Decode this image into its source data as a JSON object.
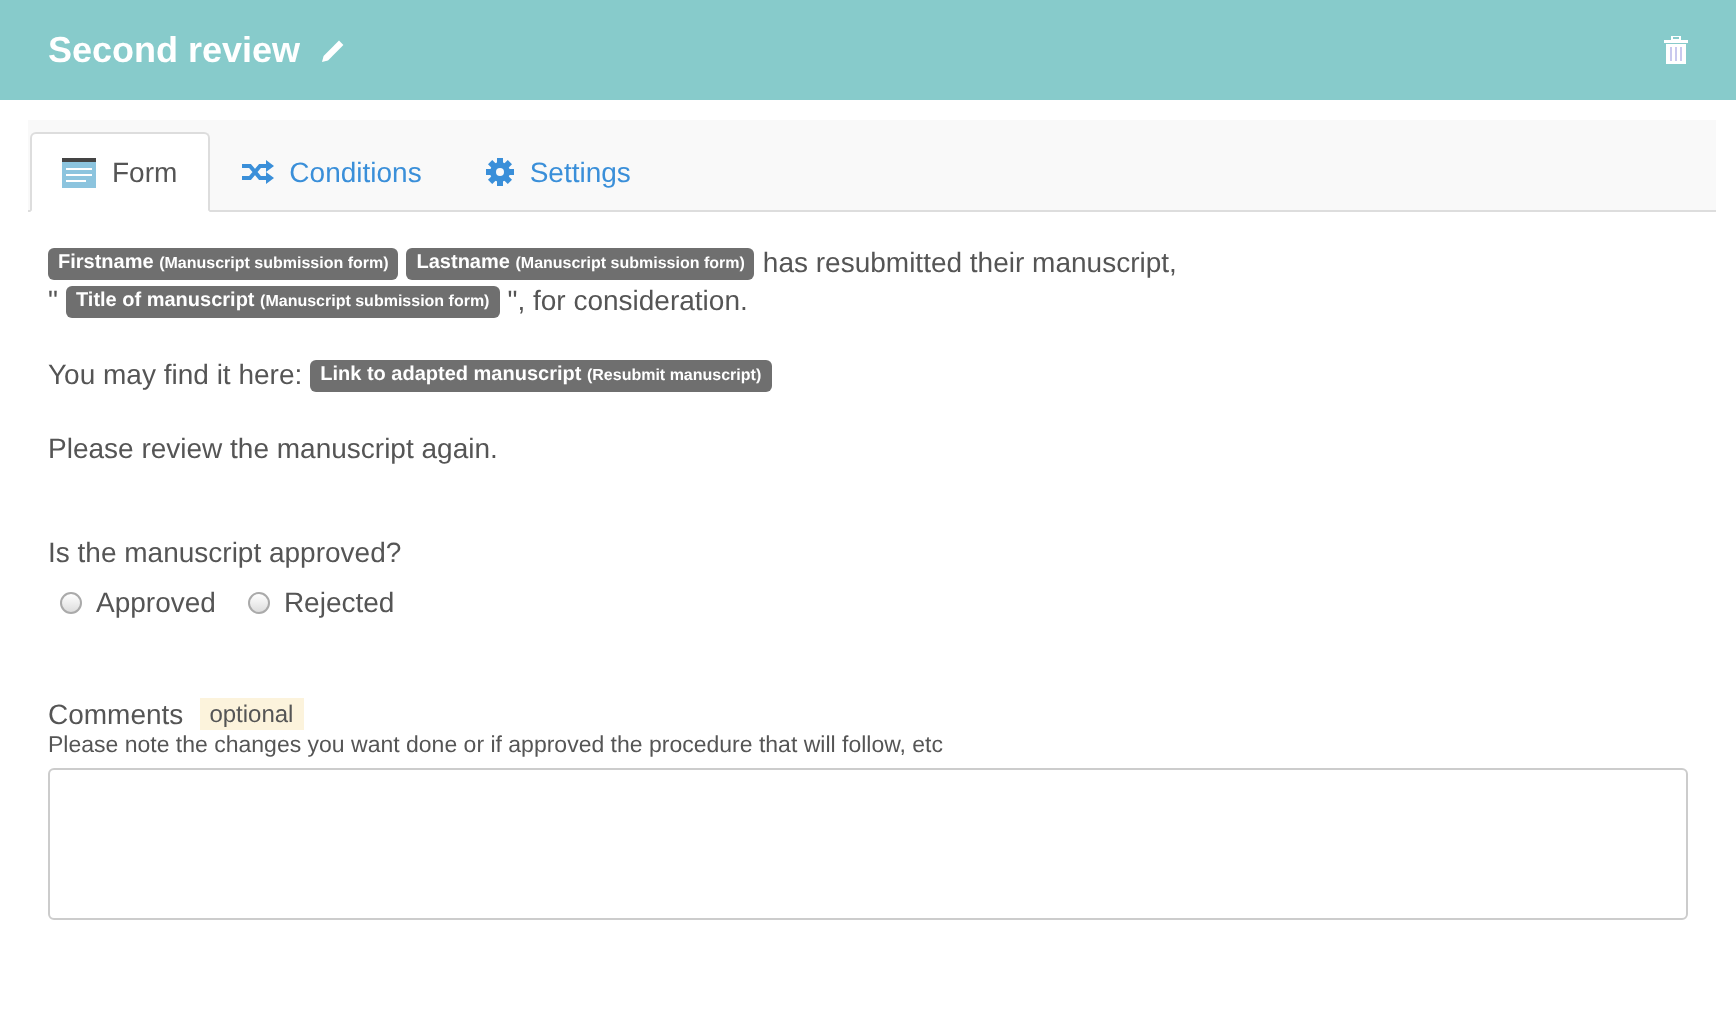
{
  "header": {
    "title": "Second review"
  },
  "tabs": [
    {
      "label": "Form",
      "selected": true
    },
    {
      "label": "Conditions",
      "selected": false
    },
    {
      "label": "Settings",
      "selected": false
    }
  ],
  "paragraphs": [
    {
      "lines": [
        [
          {
            "kind": "tag",
            "label": "Firstname",
            "source": "(Manuscript submission form)"
          },
          {
            "kind": "tag",
            "label": "Lastname",
            "source": "(Manuscript submission form)"
          },
          {
            "kind": "text",
            "text": "has resubmitted their manuscript,"
          }
        ],
        [
          {
            "kind": "text",
            "text": "\""
          },
          {
            "kind": "tag",
            "label": "Title of manuscript",
            "source": "(Manuscript submission form)"
          },
          {
            "kind": "text",
            "text": "\", for consideration."
          }
        ]
      ]
    },
    {
      "lines": [
        [
          {
            "kind": "text",
            "text": "You may find it here:"
          },
          {
            "kind": "tag",
            "label": "Link to adapted manuscript",
            "source": "(Resubmit manuscript)"
          }
        ]
      ]
    },
    {
      "lines": [
        [
          {
            "kind": "text",
            "text": "Please review the manuscript again."
          }
        ]
      ]
    }
  ],
  "question": {
    "label": "Is the manuscript approved?",
    "options": [
      {
        "label": "Approved",
        "selected": false
      },
      {
        "label": "Rejected",
        "selected": false
      }
    ]
  },
  "comments": {
    "label": "Comments",
    "badge": "optional",
    "hint": "Please note the changes you want done or if approved the procedure that will follow, etc"
  }
}
